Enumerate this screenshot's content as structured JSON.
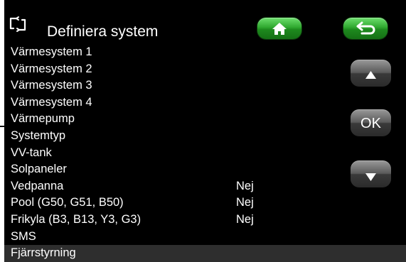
{
  "header": {
    "title": "Definiera system",
    "icon": "menu-expand-icon"
  },
  "buttons": {
    "home": {
      "icon": "home-icon",
      "color": "#2fa82f"
    },
    "back": {
      "icon": "back-arrow-icon",
      "color": "#2fa82f"
    },
    "up": {
      "icon": "arrow-up-icon"
    },
    "ok": {
      "label": "OK"
    },
    "down": {
      "icon": "arrow-down-icon"
    }
  },
  "menu": {
    "items": [
      {
        "label": "Värmesystem 1",
        "value": ""
      },
      {
        "label": "Värmesystem 2",
        "value": ""
      },
      {
        "label": "Värmesystem 3",
        "value": ""
      },
      {
        "label": "Värmesystem 4",
        "value": ""
      },
      {
        "label": "Värmepump",
        "value": ""
      },
      {
        "label": "Systemtyp",
        "value": ""
      },
      {
        "label": "VV-tank",
        "value": ""
      },
      {
        "label": "Solpaneler",
        "value": ""
      },
      {
        "label": "Vedpanna",
        "value": "Nej"
      },
      {
        "label": "Pool (G50, G51, B50)",
        "value": "Nej"
      },
      {
        "label": "Frikyla (B3, B13, Y3, G3)",
        "value": "Nej"
      },
      {
        "label": "SMS",
        "value": ""
      },
      {
        "label": "Fjärrstyrning",
        "value": ""
      }
    ],
    "selected_index": 12
  },
  "colors": {
    "background": "#000000",
    "text": "#ffffff",
    "selected_row": "#2e2e2e",
    "accent_green": "#2fa82f"
  }
}
